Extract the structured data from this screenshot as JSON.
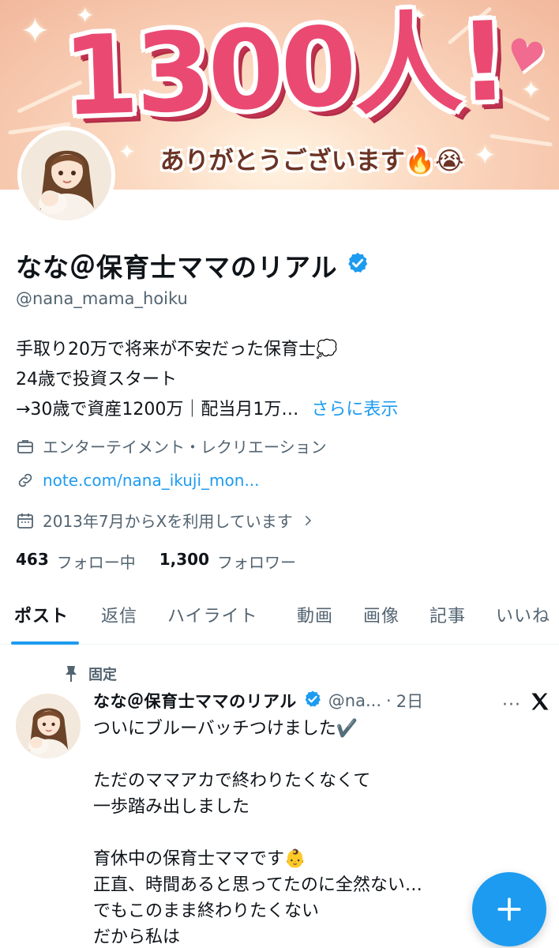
{
  "banner": {
    "count_text": "1300人!",
    "thanks_text": "ありがとうございます",
    "thanks_emojis": "🔥😭"
  },
  "profile": {
    "name": "なな＠保育士ママのリアル",
    "handle": "@nana_mama_hoiku",
    "bio_lines": [
      "手取り20万で将来が不安だった保育士",
      "24歳で投資スタート",
      "→30歳で資産1200万｜配当月1万…"
    ],
    "bio_emoji": "💭",
    "show_more": "さらに表示",
    "category": "エンターテイメント・レクリエーション",
    "link": "note.com/nana_ikuji_mon...",
    "joined": "2013年7月からXを利用しています",
    "following_count": "463",
    "following_label": "フォロー中",
    "followers_count": "1,300",
    "followers_label": "フォロワー"
  },
  "tabs": [
    {
      "label": "ポスト",
      "active": true
    },
    {
      "label": "返信",
      "active": false
    },
    {
      "label": "ハイライト",
      "active": false
    },
    {
      "label": "動画",
      "active": false
    },
    {
      "label": "画像",
      "active": false
    },
    {
      "label": "記事",
      "active": false
    },
    {
      "label": "いいね",
      "active": false
    }
  ],
  "post": {
    "pinned_label": "固定",
    "author_name": "なな＠保育士ママのリアル",
    "author_handle": "@na...",
    "time": "2日",
    "more": "···",
    "lines": [
      "ついにブルーバッチつけました✔️",
      "",
      "ただのママアカで終わりたくなくて",
      "一歩踏み出しました",
      "",
      "育休中の保育士ママです👶",
      "正直、時間あると思ってたのに全然ない…",
      "でもこのまま終わりたくない",
      "だから私は"
    ]
  },
  "colors": {
    "accent": "#1d9bf0",
    "text_primary": "#0f1419",
    "text_secondary": "#536471",
    "banner_pink": "#ea4a72"
  },
  "icons": {
    "verified": "verified-badge-icon",
    "briefcase": "briefcase-icon",
    "link": "link-icon",
    "calendar": "calendar-icon",
    "chevron": "chevron-right-icon",
    "pin": "pin-icon",
    "x_logo": "x-logo-icon",
    "compose": "plus-icon"
  }
}
